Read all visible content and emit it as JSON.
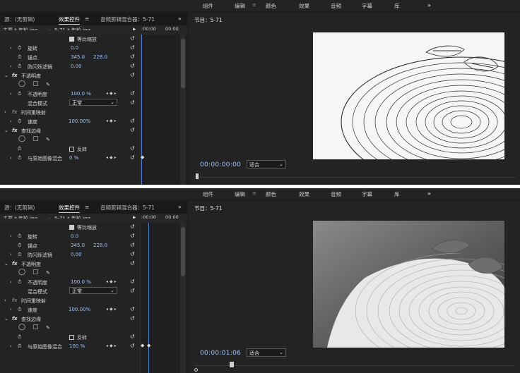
{
  "menu": {
    "items": [
      "组件",
      "编辑",
      "颜色",
      "效果",
      "音频",
      "字幕",
      "库"
    ],
    "overflow": "»",
    "menu_icon": "≡"
  },
  "panels": {
    "source_tab": "源：(无剪辑)",
    "effect_controls_tab": "效果控件",
    "audio_mixer_tab": "音频剪辑混合器：5-71",
    "overflow": "»",
    "program_title": "节目：5-71"
  },
  "sequence": {
    "master": "主要 * 年轮.jpg",
    "clip": "5-71 * 年轮.jpg",
    "play_icon": "▶",
    "ruler_times": [
      ":00:00",
      "00:00"
    ]
  },
  "states": [
    {
      "params": {
        "uniform_scale": "等比缩放",
        "rotation_label": "旋转",
        "rotation_value": "0.0",
        "anchor_label": "锚点",
        "anchor_x": "345.0",
        "anchor_y": "228.0",
        "antiflicker_label": "防闪烁滤镜",
        "antiflicker_value": "0.00",
        "opacity_section": "不透明度",
        "opacity_label": "不透明度",
        "opacity_value": "100.0 %",
        "blend_label": "混合模式",
        "blend_value": "正常",
        "time_remap_section": "时间重映射",
        "speed_label": "速度",
        "speed_value": "100.00%",
        "find_edges_section": "查找边缘",
        "invert_label": "反转",
        "blend_original_label": "与原始图像混合",
        "blend_original_value": "0 %"
      },
      "timecode": "00:00:00:00",
      "fit": "适合",
      "playhead_fraction": 0.0
    },
    {
      "params": {
        "uniform_scale": "等比缩放",
        "rotation_label": "旋转",
        "rotation_value": "0.0",
        "anchor_label": "锚点",
        "anchor_x": "345.0",
        "anchor_y": "228.0",
        "antiflicker_label": "防闪烁滤镜",
        "antiflicker_value": "0.00",
        "opacity_section": "不透明度",
        "opacity_label": "不透明度",
        "opacity_value": "100.0 %",
        "blend_label": "混合模式",
        "blend_value": "正常",
        "time_remap_section": "时间重映射",
        "speed_label": "速度",
        "speed_value": "100.00%",
        "find_edges_section": "查找边缘",
        "invert_label": "反转",
        "blend_original_label": "与原始图像混合",
        "blend_original_value": "100 %"
      },
      "timecode": "00:00:01:06",
      "fit": "适合",
      "playhead_fraction": 0.11
    }
  ],
  "colors": {
    "timecode": "#9ec6ff",
    "panel_bg": "#232323",
    "frame_bg": "#1e1e1e"
  }
}
